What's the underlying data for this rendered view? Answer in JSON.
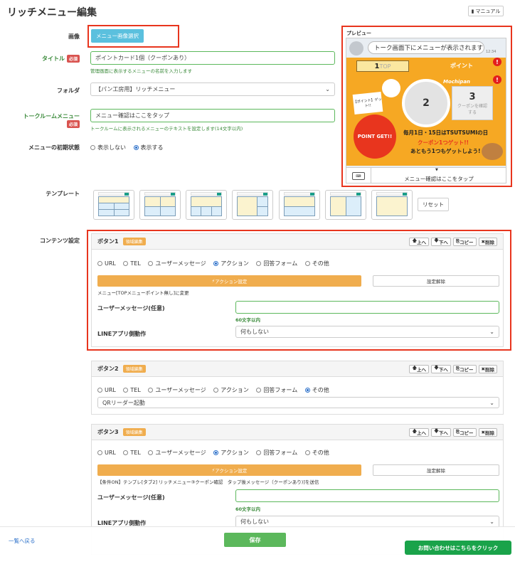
{
  "page": {
    "title": "リッチメニュー編集",
    "manual_label": "マニュアル"
  },
  "form": {
    "image_label": "画像",
    "image_button": "メニュー画像選択",
    "title_label": "タイトル",
    "required": "必須",
    "title_value": "ポイントカード1個（クーポンあり）",
    "title_hint": "管理画面に表示するメニューの名前を入力します",
    "folder_label": "フォルダ",
    "folder_value": "【パン工房用】リッチメニュー",
    "talkroom_label": "トークルームメニュー",
    "talkroom_value": "メニュー確認はここをタップ",
    "talkroom_hint": "トークルームに表示されるメニューのテキストを設定します(14文字以内)",
    "initial_label": "メニューの初期状態",
    "initial_options": [
      "表示しない",
      "表示する"
    ],
    "initial_selected": "表示する",
    "template_label": "テンプレート",
    "reset_label": "リセット",
    "content_label": "コンテンツ設定"
  },
  "preview": {
    "label": "プレビュー",
    "bubble_text": "トーク画面下にメニューが表示されます",
    "time": "12:34",
    "area_numbers": [
      "1",
      "2",
      "3"
    ],
    "area_labels": {
      "top_left": "TOP",
      "top_right": "ポイント"
    },
    "card_text": "POINT GET!!",
    "card_small": "【ポイント】ゲット!!",
    "brand": "Mochipan",
    "coupon_text": "クーポンを確認する",
    "banner_line1": "毎月1日・15日はTSUTSUMIの日",
    "banner_line2": "クーポン1つゲット!!",
    "banner_line3": "あともう1つもゲットしよう!",
    "tap_text": "メニュー確認はここをタップ",
    "keyboard_icon": "keyboard-icon",
    "colors": {
      "banner": "#f6a823",
      "red_accent": "#e8351e",
      "alert": "#e31e1e"
    }
  },
  "buttons_common": {
    "area_edit": "領域編集",
    "up": "上へ",
    "down": "下へ",
    "copy": "コピー",
    "delete": "削除",
    "types": [
      "URL",
      "TEL",
      "ユーザーメッセージ",
      "アクション",
      "回答フォーム",
      "その他"
    ],
    "action_setting": "アクション設定",
    "clear_setting": "設定解除",
    "user_message_label": "ユーザーメッセージ(任意)",
    "char_hint": "60文字以内",
    "line_app_label": "LINEアプリ側動作",
    "line_app_value": "何もしない"
  },
  "button1": {
    "title": "ボタン1",
    "selected": "アクション",
    "action_desc": "メニュー[TOPメニューポイント無し]に変更"
  },
  "button2": {
    "title": "ボタン2",
    "selected": "その他",
    "other_value": "QRリーダー起動"
  },
  "button3": {
    "title": "ボタン3",
    "selected": "アクション",
    "action_desc": "【条件ON】テンプレ[タブ2] リッチメニュー③クーポン確認　タップ後メッセージ（クーポンあり)]を送信"
  },
  "footer": {
    "back_label": "一覧へ戻る",
    "save_label": "保存",
    "contact_label": "お問い合わせはこちらをクリック"
  }
}
